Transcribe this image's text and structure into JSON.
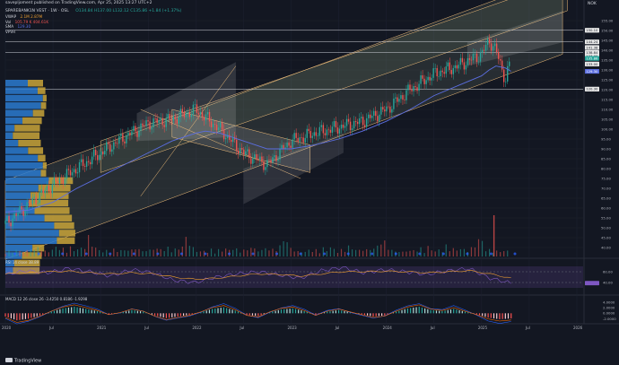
{
  "header": {
    "publisher": "savepljoment published on TradingView.com, Apr 25, 2025 13:27 UTC+2",
    "symbol": "SPAREBANK1N VEST · 1W · OSL",
    "ohlc": "O134.84 H137.00 L132.12 C135.86 +1.84 (+1.37%)",
    "vwap_label": "VWAP",
    "vwap_vals": "2.1M  2.87M",
    "vol_label": "Vol",
    "vol_vals": "105.79 K  404.61K",
    "sma_label": "SMA",
    "sma_val": "129.30",
    "vpvr_label": "VPVR"
  },
  "currency": "NOK",
  "watermark": "TradingView",
  "colors": {
    "bg": "#131722",
    "up": "#26a69a",
    "down": "#ef5350",
    "sma": "#5b6ee1",
    "channel": "#f4c07a",
    "vp_up": "#2b7bd0",
    "vp_down": "#c9a43a",
    "rsi": "#7e57c2",
    "rsi_ma": "#f0a030",
    "macd": "#2962ff",
    "signal": "#ff6d00"
  },
  "chart_data": [
    {
      "type": "line",
      "title": "",
      "y_ticks": [
        40,
        45,
        50,
        55,
        60,
        65,
        70,
        75,
        80,
        85,
        90,
        95,
        100,
        105,
        110,
        115,
        120,
        125,
        130,
        135,
        140,
        145,
        150,
        155
      ],
      "ylim": [
        35,
        160
      ],
      "x_ticks": [
        "2020",
        "Jul",
        "2021",
        "Jul",
        "2022",
        "Jul",
        "2023",
        "Jul",
        "2024",
        "Jul",
        "2025",
        "Jul",
        "2026"
      ],
      "x": [
        2020.0,
        2020.25,
        2020.5,
        2020.75,
        2021.0,
        2021.25,
        2021.5,
        2021.75,
        2022.0,
        2022.1,
        2022.25,
        2022.5,
        2022.75,
        2023.0,
        2023.25,
        2023.5,
        2023.75,
        2024.0,
        2024.25,
        2024.5,
        2024.75,
        2025.0,
        2025.08,
        2025.15,
        2025.25,
        2025.31
      ],
      "series": [
        {
          "values": [
            52,
            62,
            72,
            80,
            88,
            96,
            103,
            105,
            110,
            106,
            100,
            88,
            82,
            94,
            98,
            101,
            104,
            110,
            120,
            128,
            132,
            138,
            145,
            140,
            125,
            136
          ]
        },
        {
          "values": [
            58,
            59,
            63,
            70,
            76,
            82,
            88,
            94,
            98,
            99,
            98,
            94,
            90,
            90,
            92,
            95,
            99,
            104,
            110,
            117,
            122,
            127,
            130,
            132,
            131,
            129.3
          ]
        }
      ],
      "price_labels": [
        {
          "value": 150.1,
          "label": "150.10"
        },
        {
          "value": 144.24,
          "label": "144.24"
        },
        {
          "value": 141.38,
          "label": "141.38"
        },
        {
          "value": 138.84,
          "label": "138.84"
        },
        {
          "value": 137.0,
          "label": "137.00"
        },
        {
          "value": 135.86,
          "label": "135.86"
        },
        {
          "value": 133.0,
          "label": "133.00"
        },
        {
          "value": 129.3,
          "label": "129.30"
        },
        {
          "value": 120.3,
          "label": "120.30"
        }
      ],
      "volume": [
        20,
        25,
        18,
        30,
        22,
        28,
        24,
        35,
        26,
        40,
        30,
        22,
        28,
        26,
        45,
        30,
        34,
        25,
        38,
        28,
        30,
        36,
        42,
        80,
        60,
        35,
        28
      ]
    },
    {
      "type": "line",
      "title": "",
      "legend": "RSI 14 close 38.89",
      "y_ticks": [
        40.0,
        60.0
      ],
      "ylim": [
        20,
        80
      ],
      "series": [
        {
          "values": [
            55,
            62,
            58,
            66,
            60,
            52,
            64,
            58,
            44,
            40,
            50,
            56,
            60,
            54,
            48,
            62,
            68,
            58,
            64,
            60,
            55,
            62,
            66,
            48,
            38.9
          ]
        },
        {
          "values": [
            56,
            58,
            60,
            61,
            58,
            56,
            58,
            56,
            50,
            46,
            48,
            52,
            56,
            55,
            52,
            56,
            60,
            60,
            61,
            60,
            58,
            60,
            62,
            56,
            48
          ]
        }
      ]
    },
    {
      "type": "bar",
      "title": "",
      "legend": "MACD 12 26 close 26 -3.4250 0.8186 -1.9298",
      "y_ticks": [
        4.0,
        2.0,
        0.0,
        -2.0
      ],
      "ylim": [
        -3.2,
        5.4
      ],
      "values": [
        -1.2,
        -2.6,
        -2.0,
        -0.8,
        0.6,
        1.8,
        2.4,
        1.6,
        0.8,
        -0.4,
        0.2,
        1.2,
        0.6,
        -0.8,
        -1.8,
        -1.2,
        -0.6,
        0.4,
        1.6,
        2.2,
        1.0,
        -0.6,
        -1.0,
        0.4,
        1.4,
        1.8,
        0.8,
        -0.6,
        0.6,
        1.2,
        0.4,
        -0.4,
        -1.2,
        -0.8,
        0.6,
        1.8,
        2.4,
        1.2,
        0.8,
        1.6,
        0.6,
        -0.4,
        -1.6,
        -2.2,
        -1.9
      ]
    }
  ]
}
